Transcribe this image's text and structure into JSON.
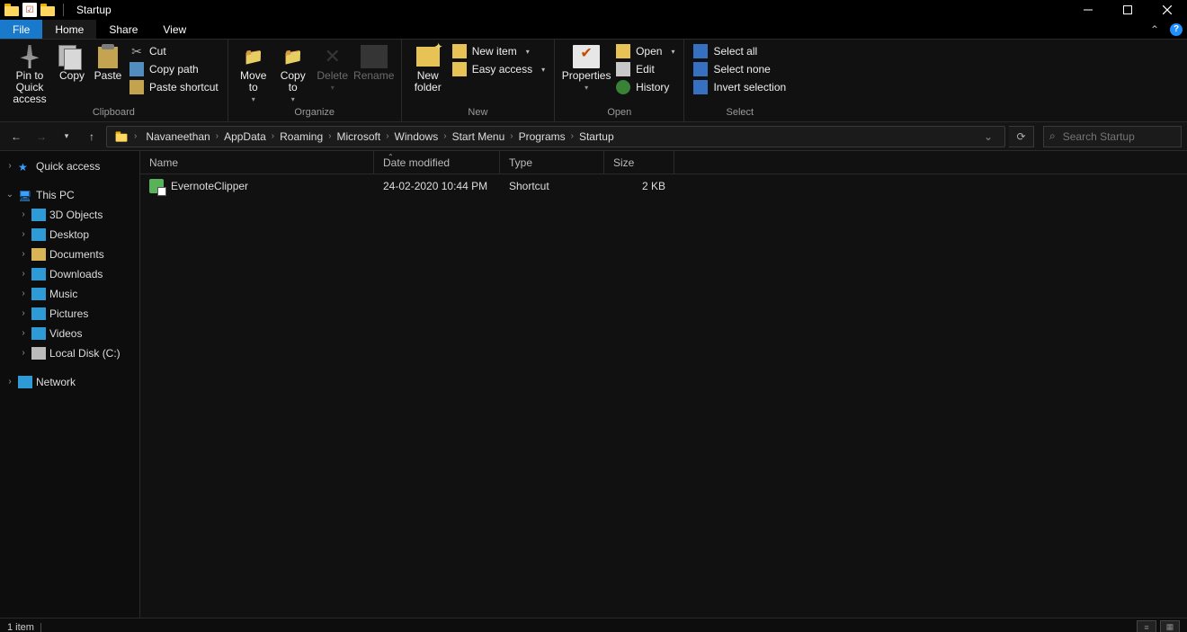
{
  "window": {
    "title": "Startup"
  },
  "tabs": {
    "file": "File",
    "home": "Home",
    "share": "Share",
    "view": "View"
  },
  "ribbon": {
    "clipboard": {
      "label": "Clipboard",
      "pin": "Pin to Quick\naccess",
      "copy": "Copy",
      "paste": "Paste",
      "cut": "Cut",
      "copypath": "Copy path",
      "pasteshort": "Paste shortcut"
    },
    "organize": {
      "label": "Organize",
      "moveto": "Move\nto",
      "copyto": "Copy\nto",
      "delete": "Delete",
      "rename": "Rename"
    },
    "new_": {
      "label": "New",
      "newfolder": "New\nfolder",
      "newitem": "New item",
      "easy": "Easy access"
    },
    "open": {
      "label": "Open",
      "properties": "Properties",
      "open": "Open",
      "edit": "Edit",
      "history": "History"
    },
    "select": {
      "label": "Select",
      "all": "Select all",
      "none": "Select none",
      "invert": "Invert selection"
    }
  },
  "breadcrumb": [
    "Navaneethan",
    "AppData",
    "Roaming",
    "Microsoft",
    "Windows",
    "Start Menu",
    "Programs",
    "Startup"
  ],
  "search": {
    "placeholder": "Search Startup"
  },
  "tree": {
    "quick": "Quick access",
    "thispc": "This PC",
    "items": [
      "3D Objects",
      "Desktop",
      "Documents",
      "Downloads",
      "Music",
      "Pictures",
      "Videos",
      "Local Disk (C:)"
    ],
    "network": "Network"
  },
  "columns": {
    "name": "Name",
    "date": "Date modified",
    "type": "Type",
    "size": "Size"
  },
  "files": [
    {
      "name": "EvernoteClipper",
      "date": "24-02-2020 10:44 PM",
      "type": "Shortcut",
      "size": "2 KB"
    }
  ],
  "status": {
    "count": "1 item"
  }
}
